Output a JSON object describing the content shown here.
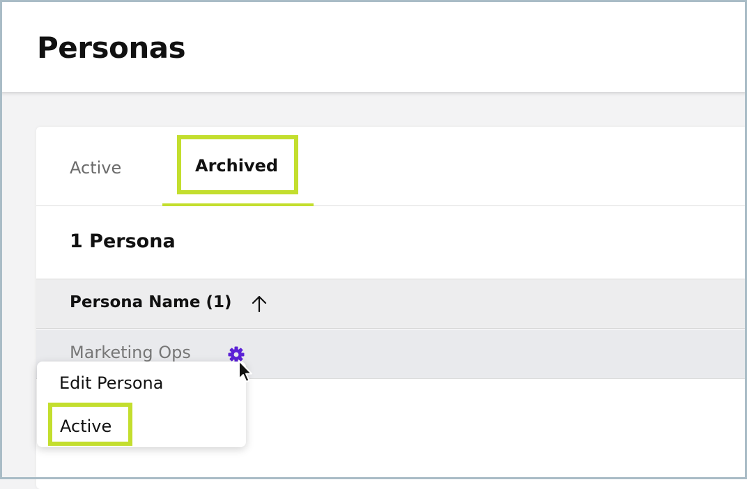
{
  "header": {
    "title": "Personas"
  },
  "tabs": [
    {
      "label": "Active",
      "selected": false
    },
    {
      "label": "Archived",
      "selected": true
    }
  ],
  "summary": {
    "count_label": "1 Persona"
  },
  "table": {
    "columns": [
      {
        "label": "Persona Name (1)",
        "sort": "ascending",
        "sort_icon": "arrow-up-icon"
      }
    ],
    "rows": [
      {
        "name": "Marketing Ops",
        "action_icon": "gear-icon"
      }
    ]
  },
  "context_menu": {
    "items": [
      {
        "label": "Edit Persona"
      },
      {
        "label": "Active",
        "highlighted": true
      }
    ]
  },
  "colors": {
    "highlight": "#c3de2e",
    "gear": "#5b21d6",
    "frame": "#a9bcc6"
  }
}
